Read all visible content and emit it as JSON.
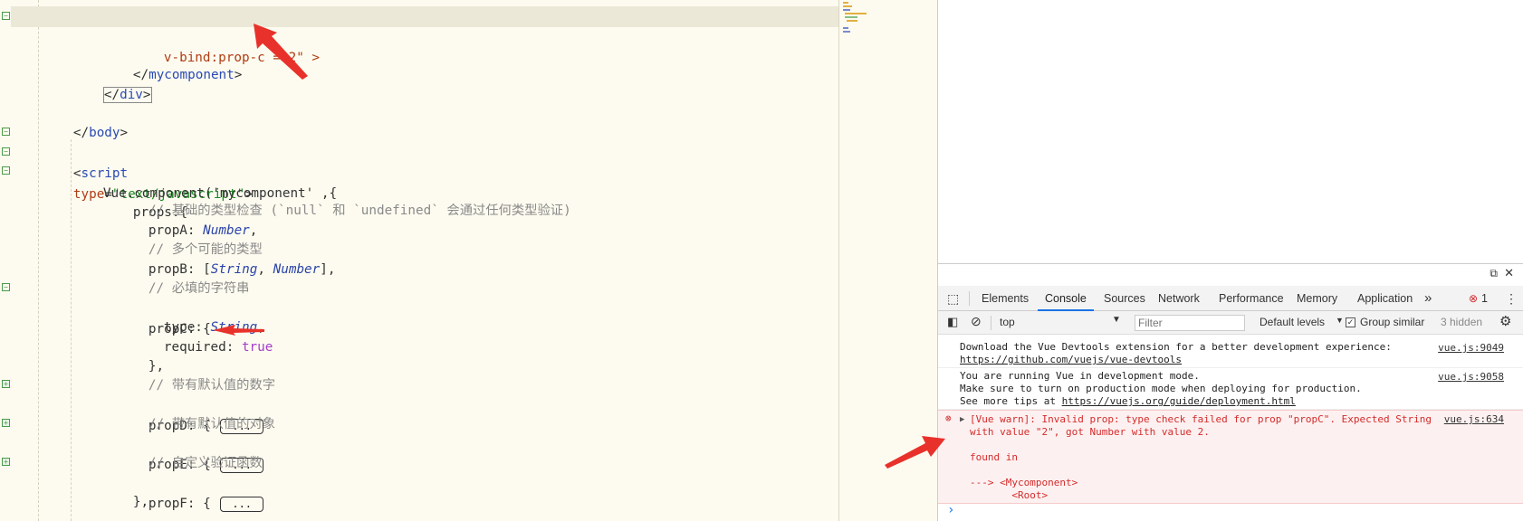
{
  "code_lines": [
    {
      "type": "partial",
      "text": "v-bind:prop-c =\"2\" >"
    },
    {
      "type": "blank"
    },
    {
      "type": "close",
      "tag": "mycomponent"
    },
    {
      "type": "close",
      "tag": "div"
    },
    {
      "type": "blank"
    },
    {
      "type": "close",
      "tag": "body"
    },
    {
      "type": "script_open",
      "tag": "script",
      "attr": "type",
      "value": "\"text/javascript\""
    },
    {
      "type": "plain",
      "text": "Vue.component('mycomponent' ,{"
    },
    {
      "type": "plain",
      "text": "props:{"
    },
    {
      "type": "comment",
      "text": "// 基础的类型检查 (`null` 和 `undefined` 会通过任何类型验证)"
    },
    {
      "type": "prop",
      "name": "propA: ",
      "value": "Number",
      "suffix": ","
    },
    {
      "type": "comment",
      "text": "// 多个可能的类型"
    },
    {
      "type": "propB",
      "name": "propB: [",
      "v1": "String",
      "sep": ", ",
      "v2": "Number",
      "suffix": "],"
    },
    {
      "type": "comment",
      "text": "// 必填的字符串"
    },
    {
      "type": "plain",
      "text": "propC: {"
    },
    {
      "type": "prop",
      "name": "type: ",
      "value": "String",
      "suffix": ","
    },
    {
      "type": "bool",
      "name": "required: ",
      "value": "true"
    },
    {
      "type": "plain",
      "text": "},"
    },
    {
      "type": "comment",
      "text": "// 带有默认值的数字"
    },
    {
      "type": "folded",
      "name": "propD: { ",
      "box": "..."
    },
    {
      "type": "comment",
      "text": "// 带有默认值的对象"
    },
    {
      "type": "folded",
      "name": "propE: { ",
      "box": "..."
    },
    {
      "type": "comment",
      "text": "// 自定义验证函数"
    },
    {
      "type": "folded",
      "name": "propF: { ",
      "box": "..."
    },
    {
      "type": "plain",
      "text": "},"
    }
  ],
  "colors": {
    "accent": "#1a73e8",
    "error": "#d42b2b",
    "arrow": "#e8312b"
  },
  "devtools": {
    "tabs": [
      "Elements",
      "Console",
      "Sources",
      "Network",
      "Performance",
      "Memory",
      "Application"
    ],
    "more": "»",
    "error_count": "1",
    "context": "top",
    "filter_placeholder": "Filter",
    "levels": "Default levels",
    "group_similar": "Group similar",
    "hidden": "3 hidden",
    "messages": [
      {
        "lines": [
          "Download the Vue Devtools extension for a better development experience:"
        ],
        "link": "https://github.com/vuejs/vue-devtools",
        "source": "vue.js:9049"
      },
      {
        "lines": [
          "You are running Vue in development mode.",
          "Make sure to turn on production mode when deploying for production.",
          "See more tips at "
        ],
        "link": "https://vuejs.org/guide/deployment.html",
        "source": "vue.js:9058"
      }
    ],
    "error": {
      "text": "[Vue warn]: Invalid prop: type check failed for prop \"propC\". Expected String\nwith value \"2\", got Number with value 2.\n\nfound in\n\n---> <Mycomponent>\n       <Root>",
      "source": "vue.js:634"
    }
  }
}
